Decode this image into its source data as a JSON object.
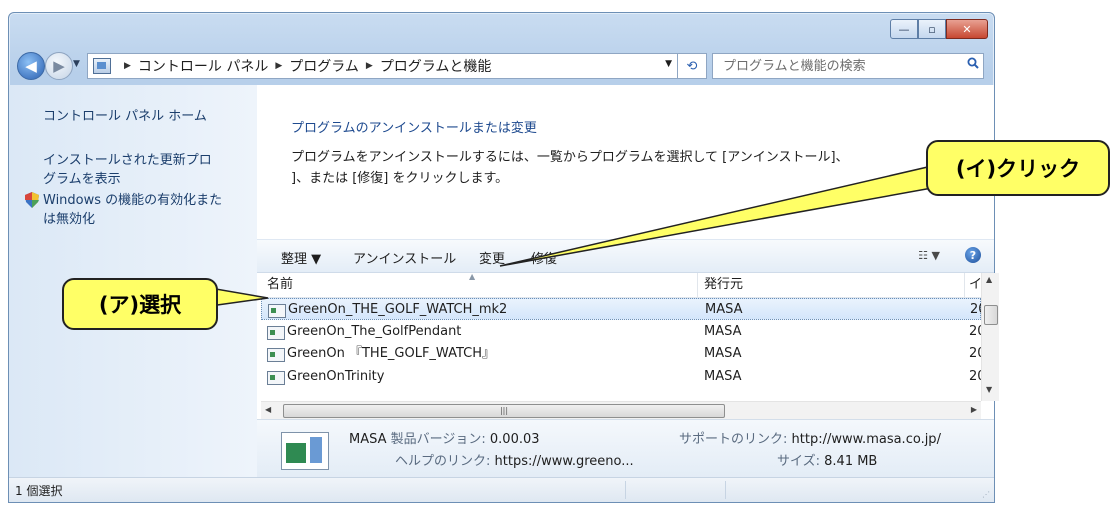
{
  "address": {
    "crumbs": [
      "コントロール パネル",
      "プログラム",
      "プログラムと機能"
    ]
  },
  "search": {
    "placeholder": "プログラムと機能の検索"
  },
  "leftpane": {
    "home_link": "コントロール パネル ホーム",
    "updates_link": [
      "インストールされた更新プロ",
      "グラムを表示"
    ],
    "features_link": [
      "Windows の機能の有効化また",
      "は無効化"
    ]
  },
  "main": {
    "heading": "プログラムのアンインストールまたは変更",
    "description": [
      "プログラムをアンインストールするには、一覧からプログラムを選択して [アンインストール]、",
      "]、または [修復] をクリックします。"
    ]
  },
  "toolbar": {
    "organize": "整理 ▼",
    "uninstall": "アンインストール",
    "change": "変更",
    "repair": "修復"
  },
  "list": {
    "columns": [
      "名前",
      "発行元",
      "イン"
    ],
    "rows": [
      {
        "name": "GreenOn_THE_GOLF_WATCH_mk2",
        "publisher": "MASA",
        "date": "20",
        "selected": true
      },
      {
        "name": "GreenOn_The_GolfPendant",
        "publisher": "MASA",
        "date": "20",
        "selected": false
      },
      {
        "name": "GreenOn 『THE_GOLF_WATCH』",
        "publisher": "MASA",
        "date": "20",
        "selected": false
      },
      {
        "name": "GreenOnTrinity",
        "publisher": "MASA",
        "date": "20",
        "selected": false
      }
    ]
  },
  "details": {
    "publisher": "MASA",
    "version_label": "製品バージョン:",
    "version_value": "0.00.03",
    "help_label": "ヘルプのリンク:",
    "help_value": "https://www.greeno...",
    "support_label": "サポートのリンク:",
    "support_value": "http://www.masa.co.jp/",
    "size_label": "サイズ:",
    "size_value": "8.41 MB"
  },
  "status": {
    "text": "1 個選択"
  },
  "callouts": {
    "select": "(ア)選択",
    "click": "(イ)クリック"
  }
}
